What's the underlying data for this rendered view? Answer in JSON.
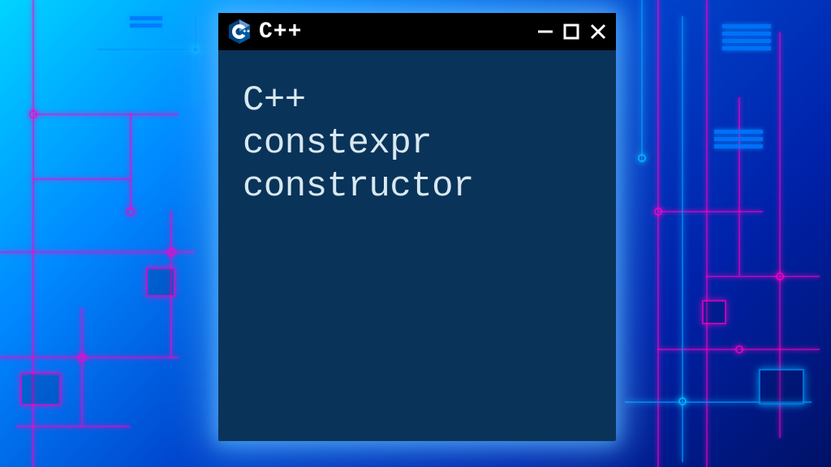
{
  "window": {
    "title": "C++",
    "body_text": "C++\nconstexpr\nconstructor"
  },
  "icons": {
    "app": "cpp-logo",
    "minimize": "minimize-icon",
    "maximize": "maximize-icon",
    "close": "close-icon"
  },
  "colors": {
    "window_bg": "#0a335a",
    "titlebar_bg": "#000000",
    "body_text": "#d8e8ef",
    "neon_pink": "#ff00c8",
    "neon_blue": "#00b4ff"
  }
}
